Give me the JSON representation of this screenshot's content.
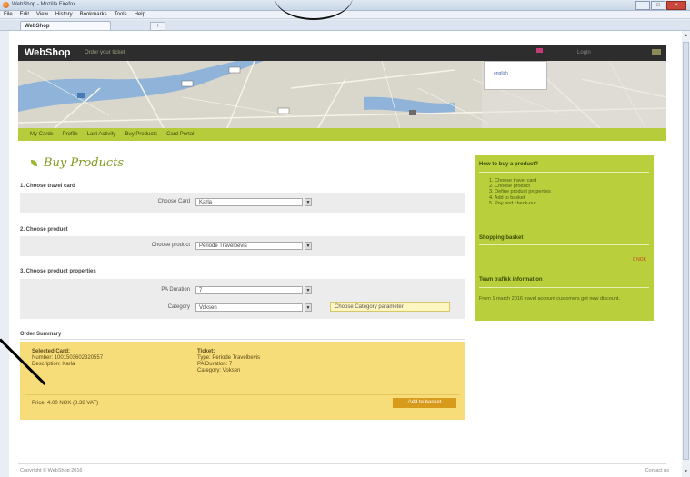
{
  "window": {
    "title": "WebShop - Mozilla Firefox"
  },
  "menu": [
    "File",
    "Edit",
    "View",
    "History",
    "Bookmarks",
    "Tools",
    "Help"
  ],
  "tab": {
    "label": "WebShop"
  },
  "header": {
    "logo": "WebShop",
    "tagline": "Order your ticket",
    "language": "english",
    "login_label": "Login"
  },
  "nav": [
    "My Cards",
    "Profile",
    "Last Activity",
    "Buy Products",
    "Card Portal"
  ],
  "page_title": "Buy Products",
  "steps": {
    "step1": {
      "label": "1. Choose travel card",
      "field_label": "Choose Card",
      "value": "Karla"
    },
    "step2": {
      "label": "2. Choose product",
      "field_label": "Choose product",
      "value": "Periode Travelbevis"
    },
    "step3": {
      "label": "3. Choose product properties",
      "duration_label": "PA Duration",
      "duration_value": "7",
      "category_label": "Category",
      "category_value": "Voksen",
      "hint": "Choose Category parameter"
    }
  },
  "summary": {
    "title": "Order Summary",
    "card_header": "Selected Card:",
    "card_number": "Number: 1001503602320557",
    "card_desc": "Description: Karla",
    "ticket_header": "Ticket:",
    "ticket_type": "Type: Periode Travelbevis",
    "ticket_duration": "PA Duration: 7",
    "ticket_category": "Category: Voksen",
    "price": "Price: 4.00 NOK (8.38 VAT)",
    "add_button": "Add to basket"
  },
  "sidebar": {
    "howto_title": "How to buy a product?",
    "howto_steps": [
      "1. Choose travel card",
      "2. Choose product",
      "3. Define product properties",
      "4. Add to basket",
      "5. Pay and check-out"
    ],
    "basket_title": "Shopping basket",
    "basket_link": "0 NOK",
    "info_title": "Team trafikk information",
    "info_text": "From 1 march 2016 travel account customers get new discount."
  },
  "footer": {
    "copyright": "Copyright © WebShop 2016",
    "contact": "Contact us"
  },
  "colors": {
    "accent_green": "#b6cc3b",
    "summary_yellow": "#f7dd7a",
    "button_orange": "#d89a1a",
    "heading_green": "#7f9a1f"
  }
}
